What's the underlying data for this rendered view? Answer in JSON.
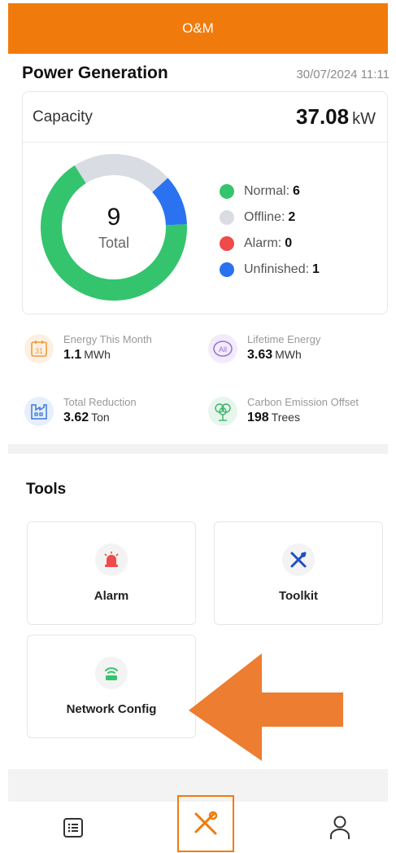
{
  "header": {
    "title": "O&M"
  },
  "power_generation": {
    "title": "Power Generation",
    "timestamp": "30/07/2024 11:11",
    "capacity_label": "Capacity",
    "capacity_value": "37.08",
    "capacity_unit": "kW",
    "total_count": "9",
    "total_label": "Total",
    "status": [
      {
        "label": "Normal:",
        "value": "6",
        "color": "#34c46e"
      },
      {
        "label": "Offline:",
        "value": "2",
        "color": "#d9dce2"
      },
      {
        "label": "Alarm:",
        "value": "0",
        "color": "#f04a4a"
      },
      {
        "label": "Unfinished:",
        "value": "1",
        "color": "#2a72f0"
      }
    ]
  },
  "stats": {
    "energy_month": {
      "label": "Energy This Month",
      "value": "1.1",
      "unit": "MWh",
      "icon": "calendar-icon",
      "icon_text": "31"
    },
    "lifetime_energy": {
      "label": "Lifetime Energy",
      "value": "3.63",
      "unit": "MWh",
      "icon": "all-icon",
      "icon_text": "All"
    },
    "total_reduction": {
      "label": "Total Reduction",
      "value": "3.62",
      "unit": "Ton",
      "icon": "factory-icon"
    },
    "carbon_offset": {
      "label": "Carbon Emission Offset",
      "value": "198",
      "unit": "Trees",
      "icon": "tree-icon"
    }
  },
  "tools": {
    "title": "Tools",
    "items": [
      {
        "label": "Alarm",
        "icon": "alarm-icon",
        "color": "#f04a4a"
      },
      {
        "label": "Toolkit",
        "icon": "toolkit-icon",
        "color": "#2a5fd6"
      },
      {
        "label": "Network Config",
        "icon": "router-icon",
        "color": "#34c46e"
      }
    ]
  },
  "bottom_nav": {
    "items": [
      {
        "icon": "list-icon"
      },
      {
        "icon": "tools-icon",
        "selected": true
      },
      {
        "icon": "user-icon"
      }
    ]
  },
  "colors": {
    "accent": "#f07b0c"
  }
}
